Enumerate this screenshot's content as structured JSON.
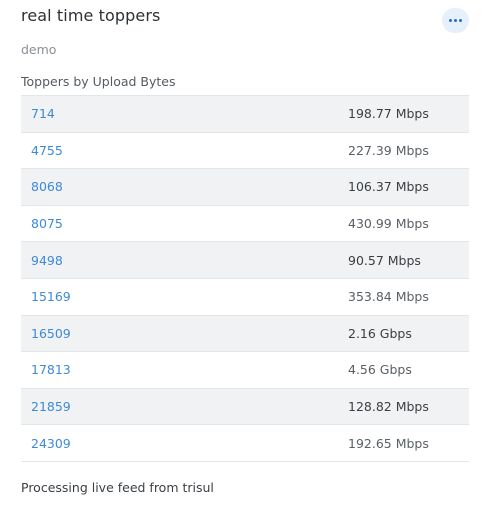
{
  "widget": {
    "title": "real time toppers",
    "subtitle": "demo",
    "section_label": "Toppers by Upload Bytes",
    "menu_icon": "more-horizontal-icon",
    "footer": "Processing live feed from trisul"
  },
  "colors": {
    "link": "#3d8ad6",
    "menu_bg": "#e6f0fb",
    "menu_dots": "#2f6cc7",
    "row_stripe": "#f1f2f3"
  },
  "toppers": [
    {
      "id": "714",
      "value": "198.77 Mbps"
    },
    {
      "id": "4755",
      "value": "227.39 Mbps"
    },
    {
      "id": "8068",
      "value": "106.37 Mbps"
    },
    {
      "id": "8075",
      "value": "430.99 Mbps"
    },
    {
      "id": "9498",
      "value": "90.57 Mbps"
    },
    {
      "id": "15169",
      "value": "353.84 Mbps"
    },
    {
      "id": "16509",
      "value": "2.16 Gbps"
    },
    {
      "id": "17813",
      "value": "4.56 Gbps"
    },
    {
      "id": "21859",
      "value": "128.82 Mbps"
    },
    {
      "id": "24309",
      "value": "192.65 Mbps"
    }
  ]
}
